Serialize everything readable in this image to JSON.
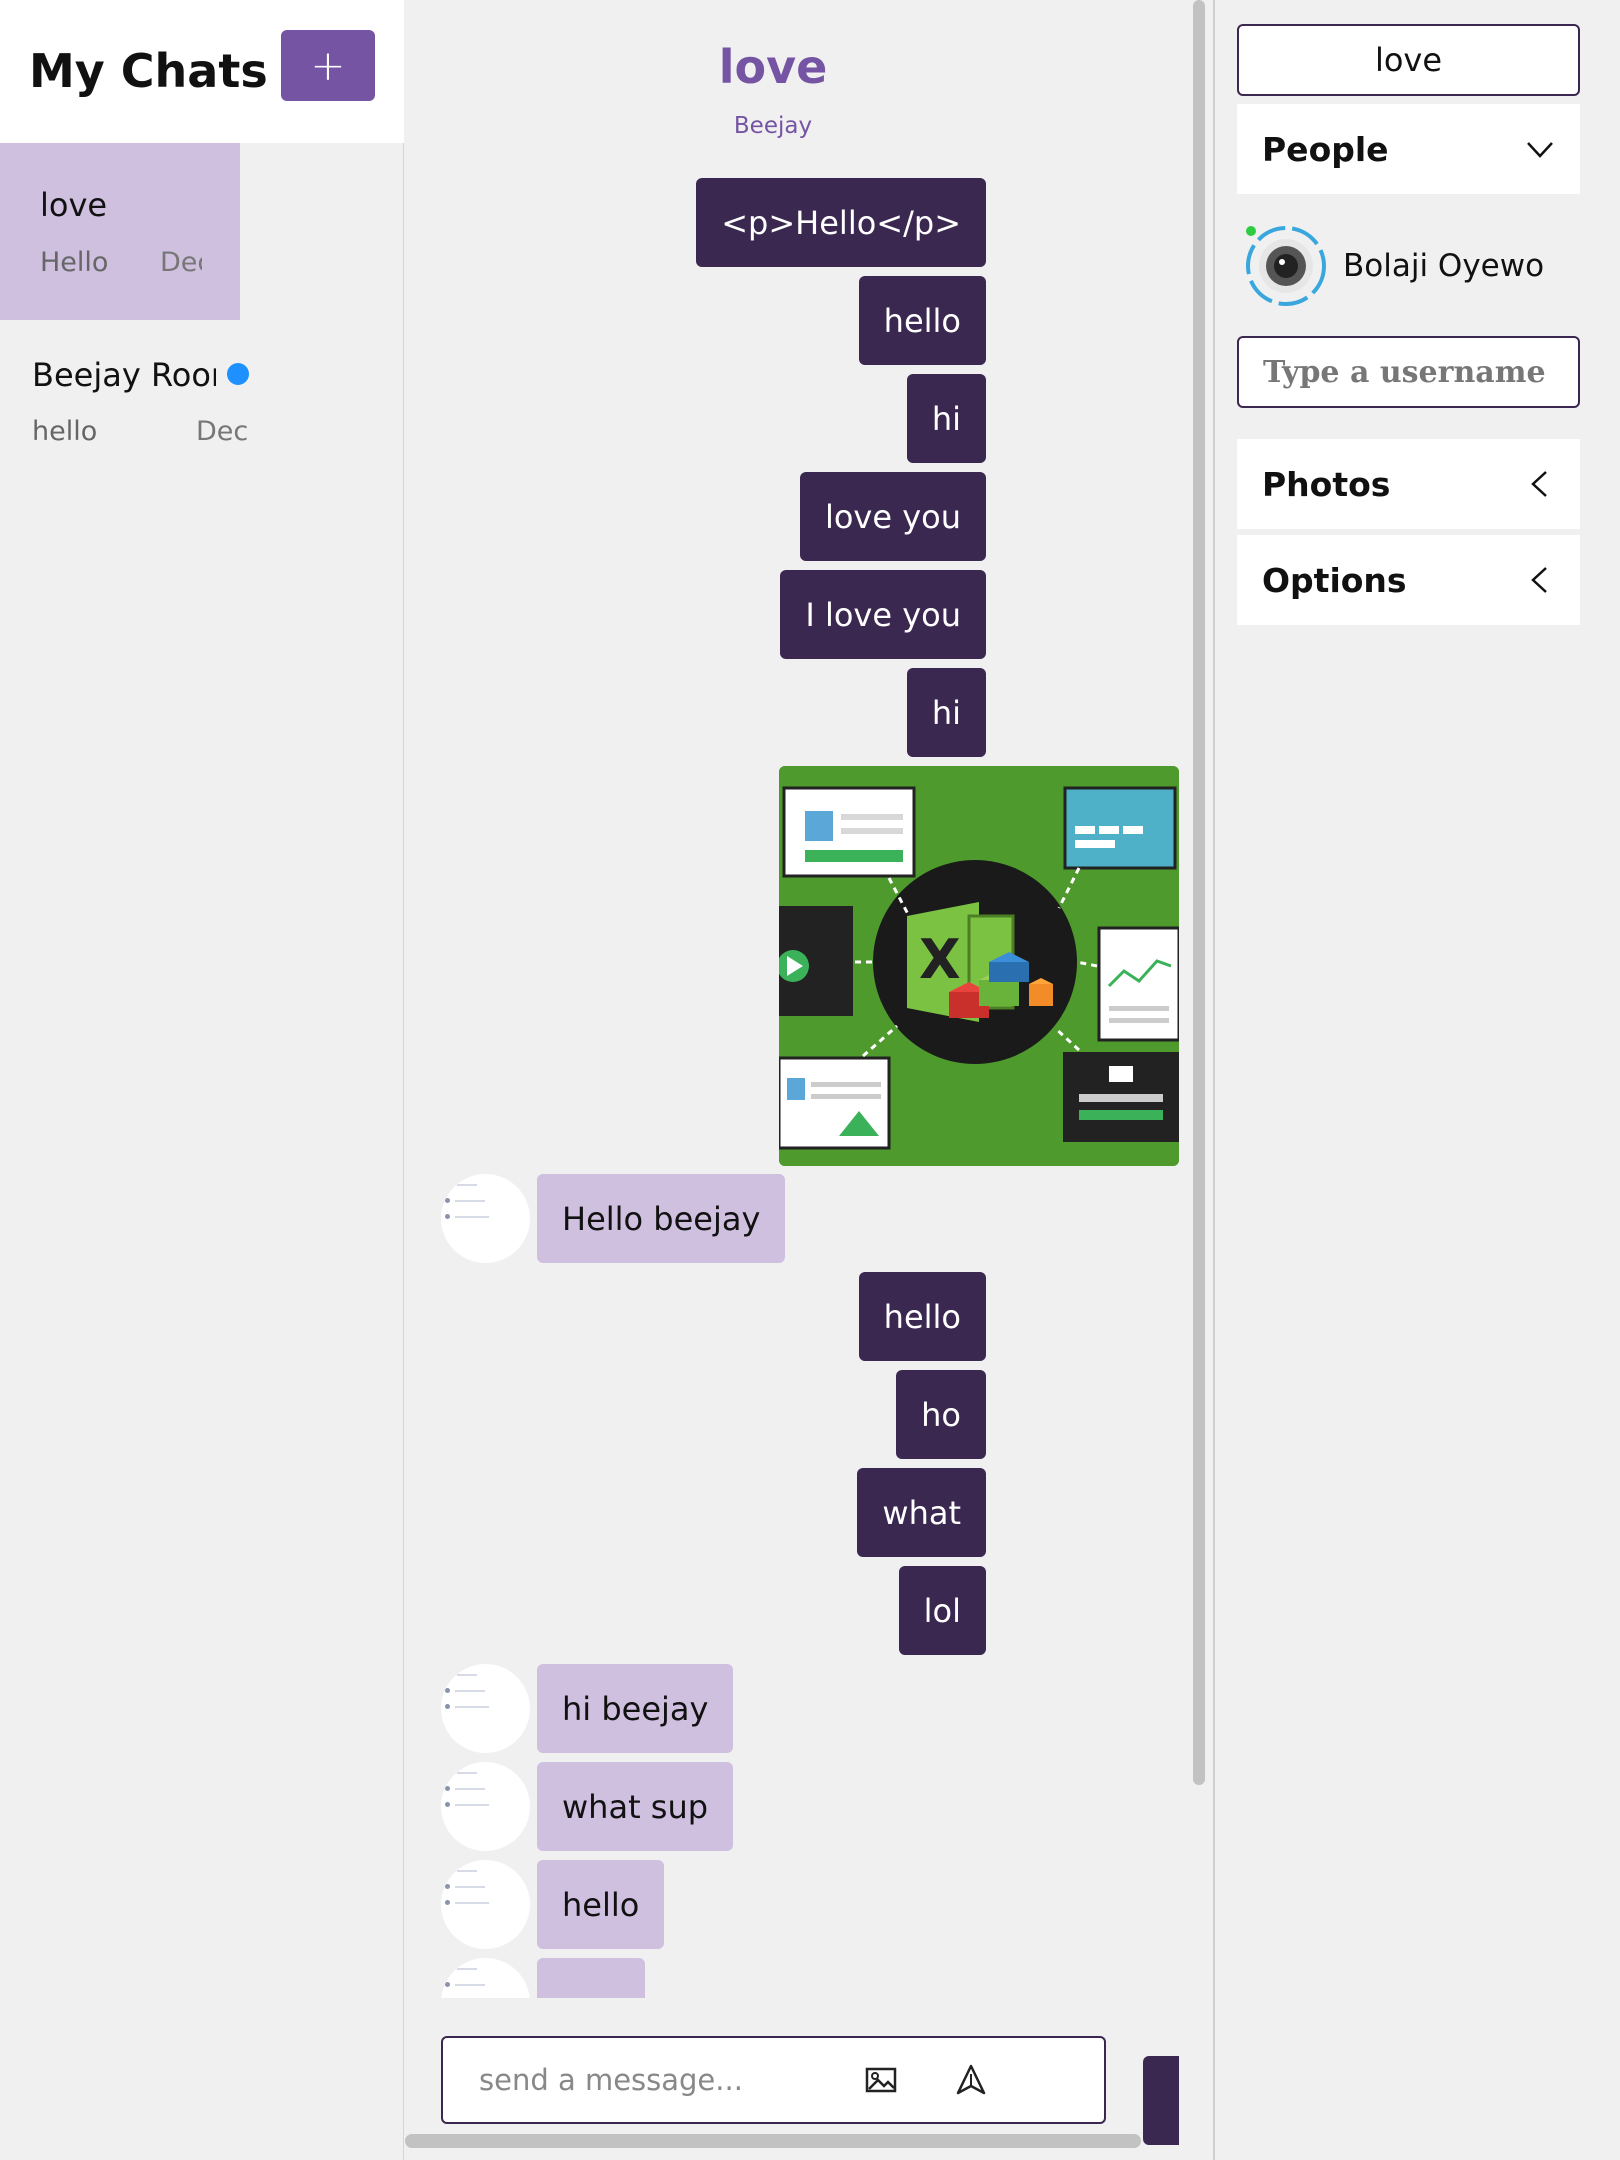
{
  "sidebar": {
    "title": "My Chats",
    "new_chat_label": "+",
    "chats": [
      {
        "name": "love",
        "preview": "Hello",
        "date": "Dec",
        "active": true
      },
      {
        "name": "Beejay Room",
        "preview": "hello",
        "date": "Dec",
        "unread": true
      }
    ]
  },
  "feed": {
    "title": "love",
    "subtitle": "Beejay",
    "messages": [
      {
        "side": "mine",
        "text": "<p>Hello</p>"
      },
      {
        "side": "mine",
        "text": "hello"
      },
      {
        "side": "mine",
        "text": "hi"
      },
      {
        "side": "mine",
        "text": "love you"
      },
      {
        "side": "mine",
        "text": "I love you"
      },
      {
        "side": "mine",
        "text": "hi"
      },
      {
        "side": "mine",
        "type": "image",
        "image": "green-excel-data-connections-illustration"
      },
      {
        "side": "theirs",
        "text": "Hello beejay"
      },
      {
        "side": "mine",
        "text": "hello"
      },
      {
        "side": "mine",
        "text": "ho"
      },
      {
        "side": "mine",
        "text": "what"
      },
      {
        "side": "mine",
        "text": "lol"
      },
      {
        "side": "theirs",
        "text": "hi beejay"
      },
      {
        "side": "theirs",
        "text": "what sup"
      },
      {
        "side": "theirs",
        "text": "hello"
      },
      {
        "side": "theirs",
        "text": ""
      },
      {
        "side": "mine",
        "text": ""
      }
    ],
    "composer": {
      "placeholder": "send a message...",
      "image_icon": "image-icon",
      "send_icon": "send-icon"
    }
  },
  "settings": {
    "title": "love",
    "people_label": "People",
    "people_icon": "chevron-down-icon",
    "people": [
      {
        "name": "Bolaji Oyewo",
        "online": true
      }
    ],
    "username_placeholder": "Type a username",
    "photos_label": "Photos",
    "photos_icon": "chevron-left-icon",
    "options_label": "Options",
    "options_icon": "chevron-left-icon"
  },
  "colors": {
    "accent": "#7554a3",
    "my_bubble": "#3a2850",
    "their_bubble": "#cfc0e0",
    "active_chat": "#cfc0e0",
    "unread_dot": "#1e90ff",
    "online_dot": "#2ecc40",
    "background": "#f0f0f0"
  }
}
